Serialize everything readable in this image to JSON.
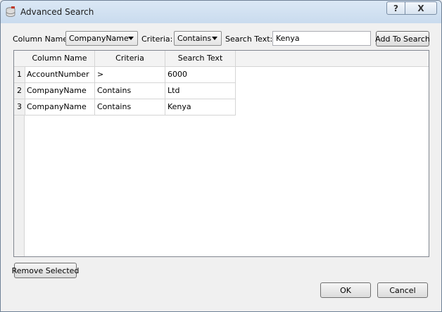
{
  "window": {
    "title": "Advanced Search",
    "help_label": "?",
    "close_label": "X"
  },
  "filter": {
    "column_label": "Column Name:",
    "column_value": "CompanyName",
    "criteria_label": "Criteria:",
    "criteria_value": "Contains",
    "search_label": "Search Text:",
    "search_value": "Kenya",
    "add_button": "Add To Search"
  },
  "grid": {
    "headers": [
      "Column Name",
      "Criteria",
      "Search Text"
    ],
    "rows": [
      {
        "num": "1",
        "column": "AccountNumber",
        "criteria": ">",
        "text": "6000"
      },
      {
        "num": "2",
        "column": "CompanyName",
        "criteria": "Contains",
        "text": "Ltd"
      },
      {
        "num": "3",
        "column": "CompanyName",
        "criteria": "Contains",
        "text": "Kenya"
      }
    ]
  },
  "buttons": {
    "remove": "Remove Selected",
    "ok": "OK",
    "cancel": "Cancel"
  }
}
